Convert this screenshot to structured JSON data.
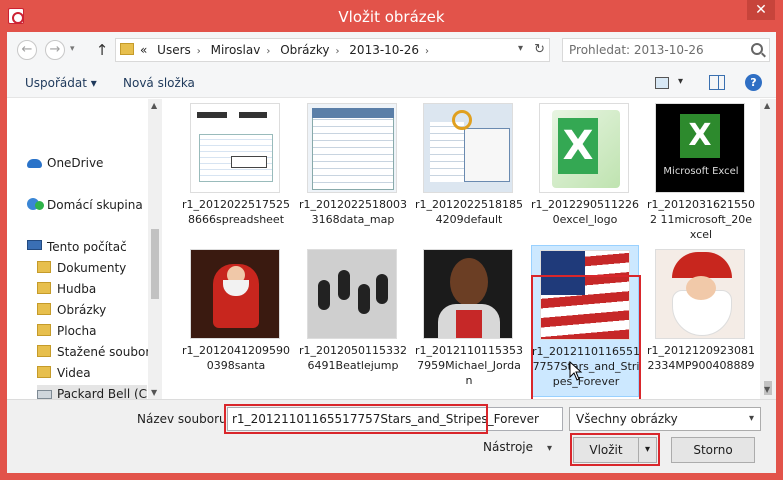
{
  "window": {
    "title": "Vložit obrázek",
    "close_glyph": "✕"
  },
  "address": {
    "path": [
      "Users",
      "Miroslav",
      "Obrázky",
      "2013-10-26"
    ],
    "overflow": "«",
    "search_placeholder": "Prohledat: 2013-10-26"
  },
  "toolbar": {
    "organize": "Uspořádat ▾",
    "new_folder": "Nová složka",
    "help": "?"
  },
  "nav": {
    "items": [
      {
        "label": "OneDrive",
        "icon": "cloud-icon"
      },
      {
        "label": "Domácí skupina",
        "icon": "homegroup-icon"
      },
      {
        "label": "Tento počítač",
        "icon": "computer-icon"
      },
      {
        "label": "Dokumenty",
        "icon": "folder-icon"
      },
      {
        "label": "Hudba",
        "icon": "folder-icon"
      },
      {
        "label": "Obrázky",
        "icon": "folder-icon"
      },
      {
        "label": "Plocha",
        "icon": "folder-icon"
      },
      {
        "label": "Stažené soubory",
        "icon": "folder-icon"
      },
      {
        "label": "Videa",
        "icon": "folder-icon"
      },
      {
        "label": "Packard Bell (C:)",
        "icon": "drive-icon"
      }
    ]
  },
  "files": [
    {
      "name": "r1_20120225175258666spreadsheet",
      "thumb": "spreadsheet"
    },
    {
      "name": "r1_20120225180033168data_map",
      "thumb": "data-map"
    },
    {
      "name": "r1_20120225181854209default",
      "thumb": "default"
    },
    {
      "name": "r1_20122905112260excel_logo",
      "thumb": "excel-logo"
    },
    {
      "name": "r1_20120316215502 11microsoft_20excel",
      "thumb": "microsoft-excel",
      "thumb_label": "Microsoft Excel"
    },
    {
      "name": "r1_20120412095900398santa",
      "thumb": "santa"
    },
    {
      "name": "r1_20120501153326491Beatlejump",
      "thumb": "beatlejump"
    },
    {
      "name": "r1_20121101153537959Michael_Jordan",
      "thumb": "michael-jordan"
    },
    {
      "name": "r1_20121101165517757Stars_and_Stripes_Forever",
      "thumb": "flag",
      "selected": true
    },
    {
      "name": "r1_20121209230812334MP900408889",
      "thumb": "santa-2"
    }
  ],
  "bottom": {
    "filename_label": "Název souboru:",
    "filename_value": "r1_20121101165517757Stars_and_Stripes_Forever",
    "filetype_value": "Všechny obrázky",
    "tools": "Nástroje",
    "insert": "Vložit",
    "cancel": "Storno"
  }
}
